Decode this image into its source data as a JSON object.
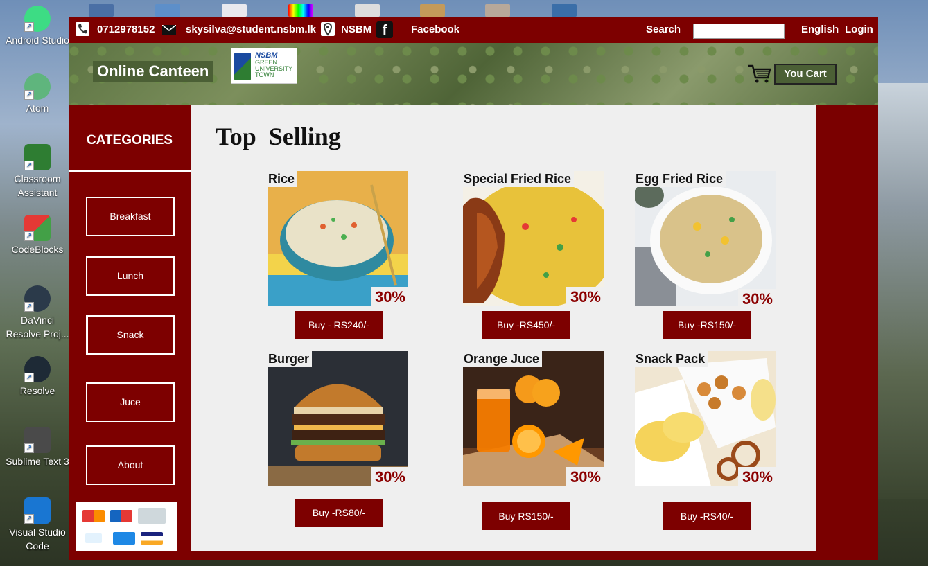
{
  "desktop": {
    "icons": [
      {
        "label": "Android Studio"
      },
      {
        "label": "Atom"
      },
      {
        "label": "Classroom Assistant"
      },
      {
        "label": "CodeBlocks"
      },
      {
        "label": "DaVinci Resolve Proj..."
      },
      {
        "label": "Resolve"
      },
      {
        "label": "Sublime Text 3"
      },
      {
        "label": "Visual Studio Code"
      }
    ]
  },
  "topbar": {
    "phone": "0712978152",
    "email": "skysilva@student.nsbm.lk",
    "location": "NSBM",
    "facebook": "Facebook",
    "search_label": "Search",
    "search_value": "",
    "language": "English",
    "login": "Login"
  },
  "header": {
    "brand": "Online Canteen",
    "logo_line1": "NSBM",
    "logo_line2": "GREEN UNIVERSITY TOWN",
    "cart_label": "You Cart"
  },
  "sidebar": {
    "title": "CATEGORIES",
    "items": [
      {
        "label": "Breakfast"
      },
      {
        "label": "Lunch"
      },
      {
        "label": "Snack"
      },
      {
        "label": "Juce"
      },
      {
        "label": "About"
      }
    ],
    "payment_cards": [
      "mastercard",
      "maestro",
      "diners-club",
      "paypal",
      "american-express",
      "visa"
    ]
  },
  "main": {
    "title": "Top  Selling",
    "products": [
      {
        "name": "Rice",
        "discount": "30%",
        "buy": "Buy - RS240/-"
      },
      {
        "name": "Special Fried Rice",
        "discount": "30%",
        "buy": "Buy -RS450/-"
      },
      {
        "name": "Egg Fried Rice",
        "discount": "30%",
        "buy": "Buy -RS150/-"
      },
      {
        "name": "Burger",
        "discount": "30%",
        "buy": "Buy -RS80/-"
      },
      {
        "name": "Orange  Juce",
        "discount": "30%",
        "buy": "Buy RS150/-"
      },
      {
        "name": "Snack Pack",
        "discount": "30%",
        "buy": "Buy -RS40/-"
      }
    ]
  },
  "colors": {
    "primary": "#7d0000",
    "panel": "#efefef",
    "discount": "#8b0000",
    "header_green": "#4b5f35"
  }
}
